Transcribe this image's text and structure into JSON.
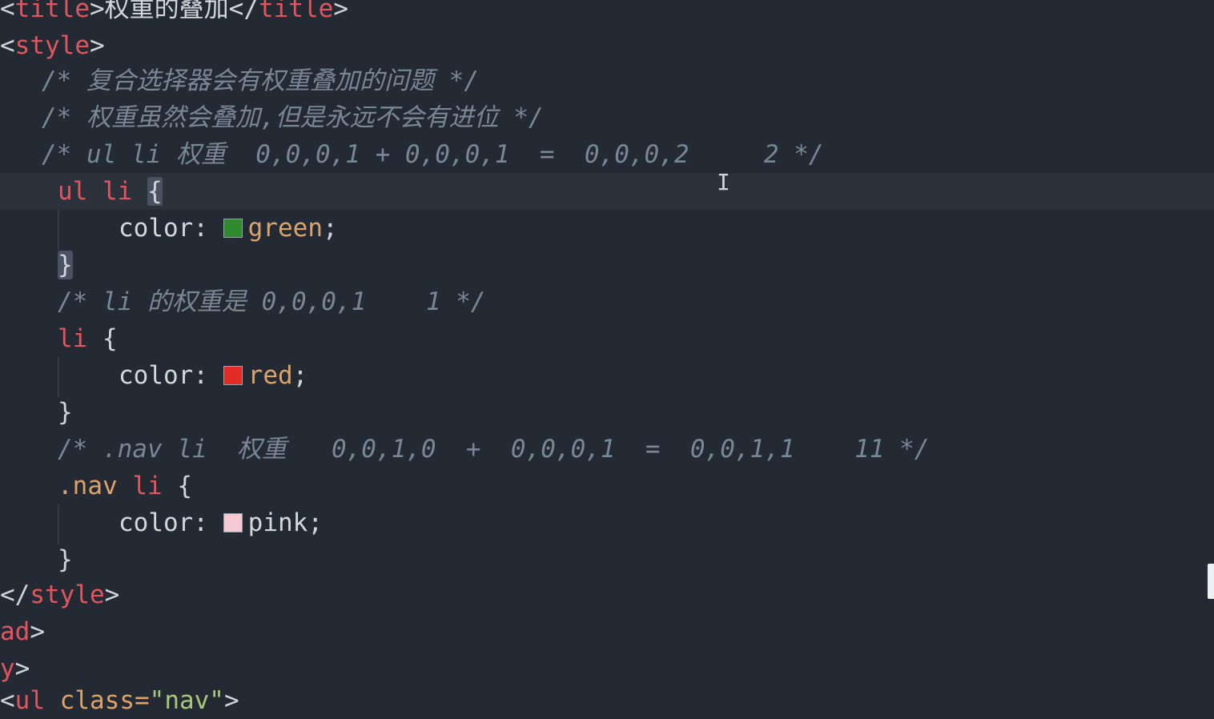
{
  "editor": {
    "colors": {
      "background": "#242a33",
      "tag": "#e2555f",
      "comment": "#7b8694",
      "value": "#dca36b",
      "swatch_green": "#2e8b2e",
      "swatch_red": "#e32b26",
      "swatch_pink": "#f5c9d2"
    },
    "lines": {
      "l1": {
        "open": "<",
        "tag": "title",
        "mid": ">",
        "text": "权重的叠加",
        "close_open": "</",
        "close_tag": "title",
        "close_end": ">"
      },
      "l2": {
        "open": "<",
        "tag": "style",
        "end": ">"
      },
      "l3": {
        "comment": "/* 复合选择器会有权重叠加的问题 */"
      },
      "l4": {
        "comment": "/* 权重虽然会叠加,但是永远不会有进位 */"
      },
      "l5": {
        "comment": "/* ul li 权重  0,0,0,1 + 0,0,0,1  =  0,0,0,2     2 */"
      },
      "l6": {
        "selector": "ul li",
        "brace": "{"
      },
      "l7": {
        "property": "color",
        "colon": ":",
        "value": "green",
        "semi": ";"
      },
      "l8": {
        "brace": "}"
      },
      "l9": {
        "comment": "/* li 的权重是 0,0,0,1    1 */"
      },
      "l10": {
        "selector": "li",
        "brace": "{"
      },
      "l11": {
        "property": "color",
        "colon": ":",
        "value": "red",
        "semi": ";"
      },
      "l12": {
        "brace": "}"
      },
      "l13": {
        "comment": "/* .nav li  权重   0,0,1,0  +  0,0,0,1  =  0,0,1,1    11 */"
      },
      "l14": {
        "class_sel": ".nav",
        "selector": "li",
        "brace": "{"
      },
      "l15": {
        "property": "color",
        "colon": ":",
        "value": "pink",
        "semi": ";"
      },
      "l16": {
        "brace": "}"
      },
      "l17": {
        "open": "</",
        "tag": "style",
        "end": ">"
      },
      "l18": {
        "tag": "ad",
        "end": ">"
      },
      "l19": {
        "tag": "y",
        "end": ">"
      },
      "l20": {
        "open": "<",
        "tag": "ul",
        "attr": " class=",
        "str": "\"nav\"",
        "end": ">"
      }
    },
    "cursor_glyph": "I"
  }
}
